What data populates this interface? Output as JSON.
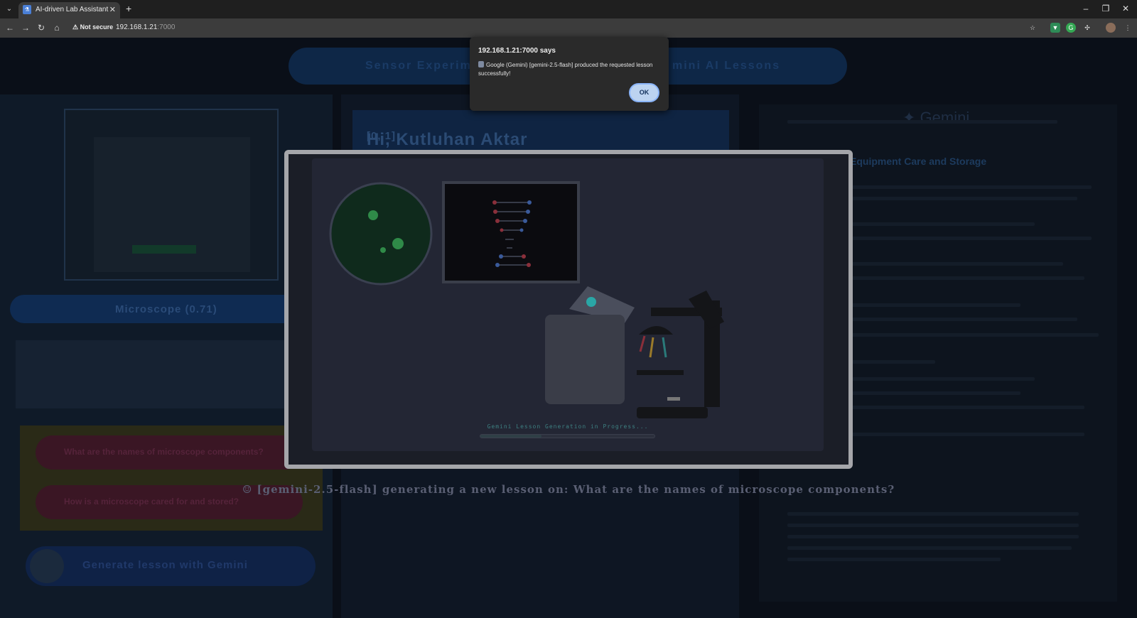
{
  "browser": {
    "tab_title": "AI-driven Lab Assistant",
    "tab_favicon": "lab-favicon-icon",
    "tab_close": "✕",
    "new_tab": "+",
    "security_label": "Not secure",
    "url_host": "192.168.1.21",
    "url_port": ":7000"
  },
  "page": {
    "title_left": "Sensor Experime",
    "title_right": "mini AI Lessons",
    "photo_label": "",
    "mic_label": "Microscope (0.71)",
    "question_1": "What are the names of microscope components?",
    "question_2": "How is a microscope cared for and stored?",
    "generate_label": "Generate lesson with Gemini",
    "greeting": "Hi, Kutluhan Aktar",
    "greeting_suffix": "[0, 1]",
    "gemini_logo": "Gemini",
    "right_heading": "Equipment Care and Storage",
    "status_line": "[gemini-2.5-flash] generating a new lesson on: What are the names of microscope components?"
  },
  "animation": {
    "progress_text": "Gemini Lesson Generation in Progress...",
    "progress_fraction": 0.35
  },
  "alert": {
    "title": "192.168.1.21:7000 says",
    "message": "Google (Gemini) [gemini-2.5-flash] produced the requested lesson successfully!",
    "ok_label": "OK"
  },
  "colors": {
    "alert_ok_bg": "#bcd3f0",
    "accent_blue": "#8ab4f8",
    "progress_text": "#3d7f80"
  }
}
